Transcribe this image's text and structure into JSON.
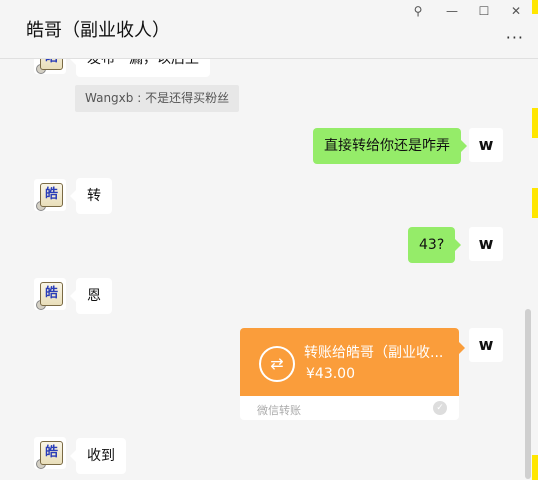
{
  "window": {
    "title": "皓哥（副业收人）",
    "pin_glyph": "⚲",
    "minimize_glyph": "—",
    "maximize_glyph": "☐",
    "close_glyph": "✕",
    "more_glyph": "···"
  },
  "messages": {
    "cut_top_text": "发布一漏，以后上",
    "system_note": "Wangxb : 不是还得买粉丝",
    "me_1": "直接转给你还是咋弄",
    "peer_1": "转",
    "me_2": "43?",
    "peer_2": "恩",
    "peer_3": "收到"
  },
  "avatars": {
    "peer_char": "皓",
    "me_char": "ᴡ"
  },
  "transfer": {
    "title": "转账给皓哥（副业收...",
    "amount": "¥43.00",
    "footer": "微信转账",
    "icon_glyph": "⇄",
    "shield_glyph": "✓"
  },
  "colors": {
    "outgoing_bubble": "#95ec69",
    "incoming_bubble": "#ffffff",
    "transfer_card": "#fa9d3b"
  }
}
